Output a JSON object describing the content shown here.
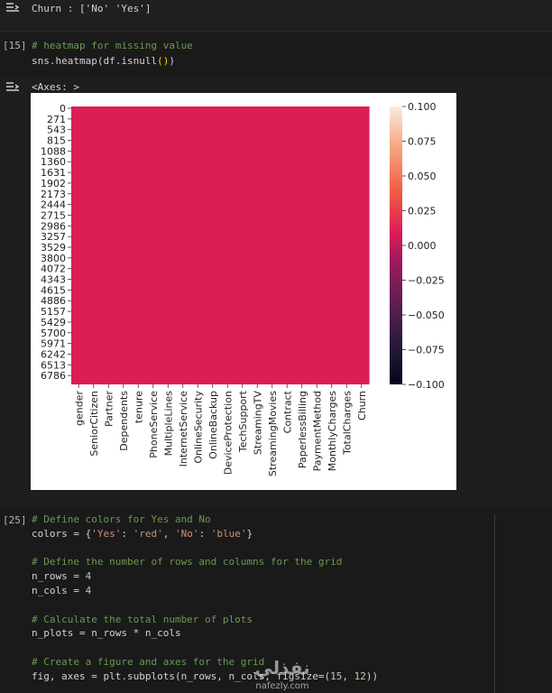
{
  "cells": {
    "top_output": {
      "text": "Churn : ['No' 'Yes']"
    },
    "cell15": {
      "number": "[15]",
      "lines": [
        {
          "tokens": [
            {
              "t": "# heatmap for missing value",
              "c": "comment"
            }
          ]
        },
        {
          "tokens": [
            {
              "t": "sns.heatmap(df.isnull",
              "c": "plain"
            },
            {
              "t": "()",
              "c": "paren"
            },
            {
              "t": ")",
              "c": "plain"
            }
          ]
        }
      ],
      "output_label": "<Axes: >"
    },
    "cell25": {
      "number": "[25]",
      "lines": [
        {
          "tokens": [
            {
              "t": "# Define colors for Yes and No",
              "c": "comment"
            }
          ]
        },
        {
          "tokens": [
            {
              "t": "colors = {",
              "c": "plain"
            },
            {
              "t": "'Yes'",
              "c": "str"
            },
            {
              "t": ": ",
              "c": "plain"
            },
            {
              "t": "'red'",
              "c": "str"
            },
            {
              "t": ", ",
              "c": "plain"
            },
            {
              "t": "'No'",
              "c": "str"
            },
            {
              "t": ": ",
              "c": "plain"
            },
            {
              "t": "'blue'",
              "c": "str"
            },
            {
              "t": "}",
              "c": "plain"
            }
          ]
        },
        {
          "tokens": []
        },
        {
          "tokens": [
            {
              "t": "# Define the number of rows and columns for the grid",
              "c": "comment"
            }
          ]
        },
        {
          "tokens": [
            {
              "t": "n_rows = ",
              "c": "plain"
            },
            {
              "t": "4",
              "c": "num"
            }
          ]
        },
        {
          "tokens": [
            {
              "t": "n_cols = ",
              "c": "plain"
            },
            {
              "t": "4",
              "c": "num"
            }
          ]
        },
        {
          "tokens": []
        },
        {
          "tokens": [
            {
              "t": "# Calculate the total number of plots",
              "c": "comment"
            }
          ]
        },
        {
          "tokens": [
            {
              "t": "n_plots = n_rows * n_cols",
              "c": "plain"
            }
          ]
        },
        {
          "tokens": []
        },
        {
          "tokens": [
            {
              "t": "# Create a figure and axes for the grid",
              "c": "comment"
            }
          ]
        },
        {
          "tokens": [
            {
              "t": "fig, axes = plt.subplots(n_rows, n_cols, figsize=(",
              "c": "plain"
            },
            {
              "t": "15",
              "c": "num"
            },
            {
              "t": ", ",
              "c": "plain"
            },
            {
              "t": "12",
              "c": "num"
            },
            {
              "t": "))",
              "c": "plain"
            }
          ]
        }
      ]
    }
  },
  "chart_data": {
    "type": "heatmap",
    "y_ticks": [
      "0",
      "271",
      "543",
      "815",
      "1088",
      "1360",
      "1631",
      "1902",
      "2173",
      "2444",
      "2715",
      "2986",
      "3257",
      "3529",
      "3800",
      "4072",
      "4343",
      "4615",
      "4886",
      "5157",
      "5429",
      "5700",
      "5971",
      "6242",
      "6513",
      "6786"
    ],
    "x_ticks": [
      "gender",
      "SeniorCitizen",
      "Partner",
      "Dependents",
      "tenure",
      "PhoneService",
      "MultipleLines",
      "InternetService",
      "OnlineSecurity",
      "OnlineBackup",
      "DeviceProtection",
      "TechSupport",
      "StreamingTV",
      "StreamingMovies",
      "Contract",
      "PaperlessBilling",
      "PaymentMethod",
      "MonthlyCharges",
      "TotalCharges",
      "Churn"
    ],
    "value_all_cells": 0.0,
    "fill_color": "#dd1d55",
    "colorbar": {
      "ticks": [
        "0.100",
        "0.075",
        "0.050",
        "0.025",
        "0.000",
        "−0.025",
        "−0.050",
        "−0.075",
        "−0.100"
      ],
      "range": [
        -0.1,
        0.1
      ],
      "colormap": "rocket"
    }
  },
  "watermark": {
    "brand_arabic": "نفذلي",
    "domain": "nafezly.com"
  }
}
